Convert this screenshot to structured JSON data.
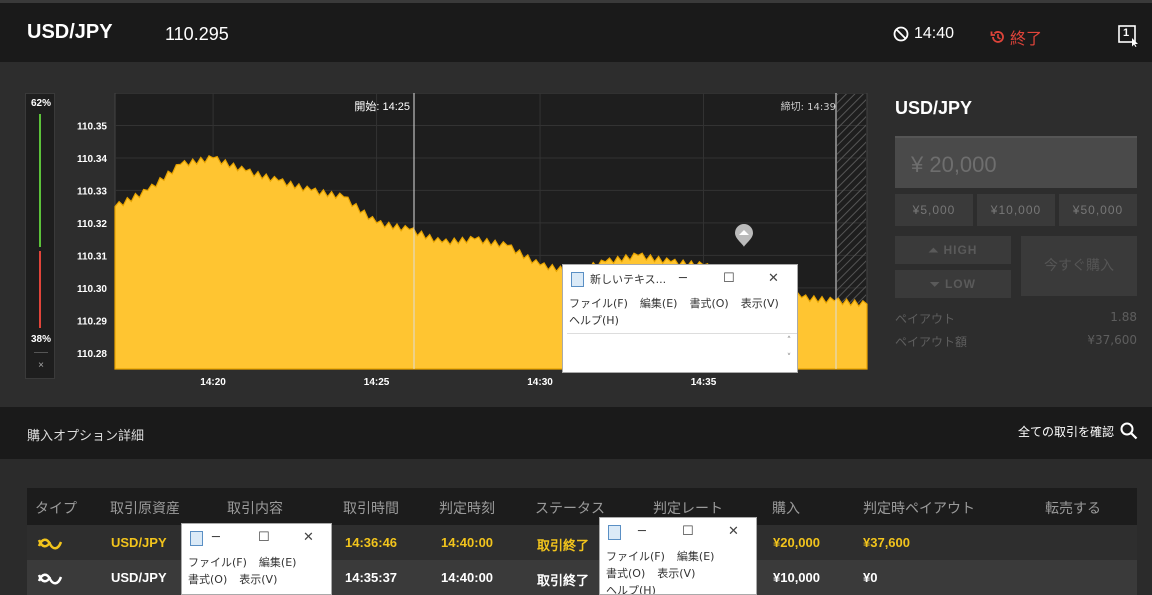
{
  "header": {
    "pair": "USD/JPY",
    "price": "110.295",
    "time": "14:40",
    "end_label": "終了",
    "window_badge": "1"
  },
  "ratio": {
    "high_pct": "62%",
    "low_pct": "38%",
    "close": "×",
    "high_value": 62,
    "low_value": 38
  },
  "chart_data": {
    "type": "area",
    "x": [
      "14:17",
      "14:18",
      "14:19",
      "14:20",
      "14:21",
      "14:22",
      "14:23",
      "14:24",
      "14:25",
      "14:26",
      "14:27",
      "14:28",
      "14:29",
      "14:30",
      "14:31",
      "14:32",
      "14:33",
      "14:34",
      "14:35",
      "14:36",
      "14:37",
      "14:38",
      "14:39",
      "14:40"
    ],
    "values": [
      110.325,
      110.33,
      110.338,
      110.34,
      110.336,
      110.333,
      110.33,
      110.328,
      110.32,
      110.318,
      110.314,
      110.315,
      110.313,
      110.307,
      110.305,
      110.308,
      110.31,
      110.308,
      110.307,
      110.303,
      110.302,
      110.297,
      110.296,
      110.295
    ],
    "ylim": [
      110.275,
      110.36
    ],
    "yticks": [
      "110.35",
      "110.34",
      "110.33",
      "110.32",
      "110.31",
      "110.30",
      "110.29",
      "110.28"
    ],
    "xticks": [
      "14:20",
      "14:25",
      "14:30",
      "14:35"
    ],
    "start_label": "開始: 14:25",
    "close_label": "締切: 14:39",
    "color": "#ffc531"
  },
  "side": {
    "title": "USD/JPY",
    "amount": "¥ 20,000",
    "quick_amounts": [
      "¥5,000",
      "¥10,000",
      "¥50,000"
    ],
    "high": "HIGH",
    "low": "LOW",
    "buy_now": "今すぐ購入",
    "payout_label": "ペイアウト",
    "payout_value": "1.88",
    "payout_amount_label": "ペイアウト額",
    "payout_amount_value": "¥37,600"
  },
  "detail": {
    "title": "購入オプション詳細",
    "all_trades": "全ての取引を確認"
  },
  "table": {
    "headers": [
      "タイプ",
      "取引原資産",
      "取引内容",
      "取引時間",
      "判定時刻",
      "ステータス",
      "判定レート",
      "購入",
      "判定時ペイアウト",
      "転売する"
    ],
    "rows": [
      {
        "asset": "USD/JPY",
        "trade_time": "14:36:46",
        "judge_time": "14:40:00",
        "status": "取引終了",
        "purchase": "¥20,000",
        "payout": "¥37,600"
      },
      {
        "asset": "USD/JPY",
        "trade_time": "14:35:37",
        "judge_time": "14:40:00",
        "status": "取引終了",
        "purchase": "¥10,000",
        "payout": "¥0"
      }
    ]
  },
  "notepads": {
    "n1_title": "新しいテキス...",
    "n2_title": "",
    "n3_title": "",
    "file": "ファイル(F)",
    "edit": "編集(E)",
    "format": "書式(O)",
    "view": "表示(V)",
    "help": "ヘルプ(H)",
    "minimize": "─",
    "maximize": "☐",
    "close": "✕"
  }
}
